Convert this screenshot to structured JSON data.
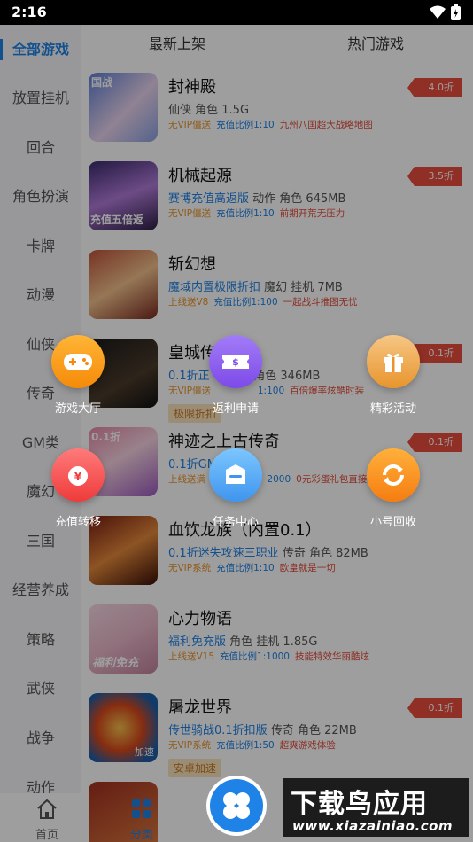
{
  "status": {
    "time": "2:16"
  },
  "tabs": {
    "newest": "最新上架",
    "hot": "热门游戏"
  },
  "sidebar": {
    "items": [
      "全部游戏",
      "放置挂机",
      "回合",
      "角色扮演",
      "卡牌",
      "动漫",
      "仙侠",
      "传奇",
      "GM类",
      "魔幻",
      "三国",
      "经营养成",
      "策略",
      "武侠",
      "战争",
      "动作"
    ],
    "active_index": 0
  },
  "games": [
    {
      "name": "封神殿",
      "tags": "仙侠 角色 1.5G",
      "tags_highlight": "",
      "perks": [
        "无VIP僵送",
        "充值比例1:10",
        "九州八国超大战略地图"
      ],
      "discount": "4.0折",
      "chip": "",
      "thumb_text": "国战"
    },
    {
      "name": "机械起源",
      "tags": "动作 角色 645MB",
      "tags_highlight": "赛博充值高返版",
      "perks": [
        "无VIP僵送",
        "充值比例1:10",
        "前期开荒无压力"
      ],
      "discount": "3.5折",
      "chip": "",
      "thumb_text": "充值五倍返"
    },
    {
      "name": "斩幻想",
      "tags": "魔幻 挂机 7MB",
      "tags_highlight": "魔域内置极限折扣",
      "perks": [
        "上线送V8",
        "充值比例1:100",
        "一起战斗推图无忧"
      ],
      "discount": "",
      "chip": "",
      "thumb_text": ""
    },
    {
      "name": "皇城传",
      "tags": "角色 346MB",
      "tags_highlight": "0.1折正",
      "perks": [
        "无VIP僵送",
        "1:100",
        "百倍爆率炫酷时装"
      ],
      "discount": "0.1折",
      "chip": "极限折扣",
      "thumb_text": ""
    },
    {
      "name": "神迹之上古传奇",
      "tags": "",
      "tags_highlight": "0.1折GM",
      "perks": [
        "上线送满",
        "2000",
        "0元彩蛋礼包直接"
      ],
      "discount": "0.1折",
      "chip": "",
      "thumb_text": "0.1折"
    },
    {
      "name": "血饮龙族（内置0.1）",
      "tags": "传奇 角色 82MB",
      "tags_highlight": "0.1折迷失攻速三职业",
      "perks": [
        "无VIP系统",
        "充值比例1:10",
        "欧皇就是一切"
      ],
      "discount": "",
      "chip": "",
      "thumb_text": ""
    },
    {
      "name": "心力物语",
      "tags": "角色 挂机 1.85G",
      "tags_highlight": "福利免充版",
      "perks": [
        "上线送V15",
        "充值比例1:1000",
        "技能特效华丽酷炫"
      ],
      "discount": "",
      "chip": "",
      "thumb_text": "福利免充"
    },
    {
      "name": "屠龙世界",
      "tags": "传奇 角色 22MB",
      "tags_highlight": "传世骑战0.1折扣版",
      "perks": [
        "无VIP系统",
        "充值比例1:50",
        "超爽游戏体验"
      ],
      "discount": "0.1折",
      "chip": "安卓加速",
      "thumb_text": "加速"
    }
  ],
  "actions": [
    {
      "label": "游戏大厅",
      "icon": "gamepad-icon",
      "color": "#f59a1b"
    },
    {
      "label": "返利申请",
      "icon": "rebate-ticket-icon",
      "color": "#8c5cf0"
    },
    {
      "label": "精彩活动",
      "icon": "gift-icon",
      "color": "#e8952c"
    },
    {
      "label": "充值转移",
      "icon": "recharge-bag-icon",
      "color": "#f04b4b"
    },
    {
      "label": "任务中心",
      "icon": "task-box-icon",
      "color": "#3fa1f3"
    },
    {
      "label": "小号回收",
      "icon": "recycle-icon",
      "color": "#f68a1e"
    }
  ],
  "nav": {
    "home": "首页",
    "category": "分类"
  },
  "watermark": {
    "title": "下载鸟应用",
    "url": "www.xiazainiao.com"
  },
  "colors": {
    "accent": "#1e82e6",
    "discount": "#e84c3d",
    "perk_orange": "#e8952c",
    "perk_red": "#e24b3a"
  }
}
